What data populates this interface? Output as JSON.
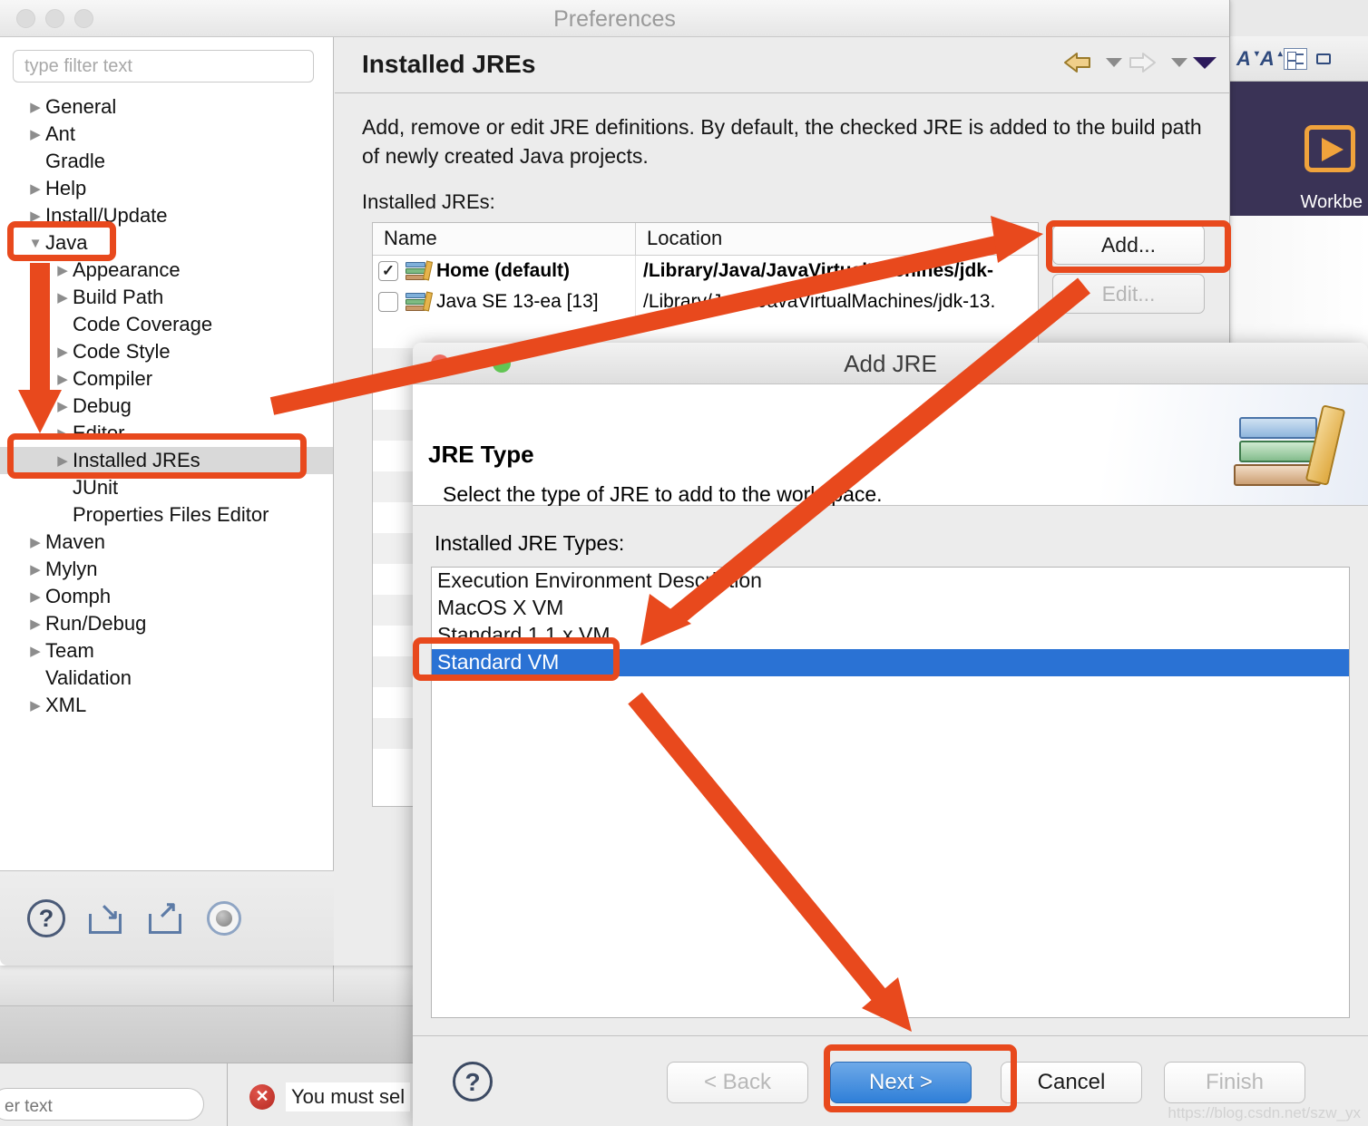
{
  "window": {
    "title": "Preferences",
    "traffic_lights": [
      "close",
      "minimize",
      "zoom"
    ]
  },
  "sidebar": {
    "filter_placeholder": "type filter text",
    "filter_value": "",
    "items": [
      {
        "label": "General",
        "level": 0,
        "twisty": "collapsed",
        "selected": false
      },
      {
        "label": "Ant",
        "level": 0,
        "twisty": "collapsed",
        "selected": false
      },
      {
        "label": "Gradle",
        "level": 0,
        "twisty": "none",
        "selected": false
      },
      {
        "label": "Help",
        "level": 0,
        "twisty": "collapsed",
        "selected": false
      },
      {
        "label": "Install/Update",
        "level": 0,
        "twisty": "collapsed",
        "selected": false
      },
      {
        "label": "Java",
        "level": 0,
        "twisty": "expanded",
        "selected": false
      },
      {
        "label": "Appearance",
        "level": 1,
        "twisty": "collapsed",
        "selected": false
      },
      {
        "label": "Build Path",
        "level": 1,
        "twisty": "collapsed",
        "selected": false
      },
      {
        "label": "Code Coverage",
        "level": 1,
        "twisty": "none",
        "selected": false
      },
      {
        "label": "Code Style",
        "level": 1,
        "twisty": "collapsed",
        "selected": false
      },
      {
        "label": "Compiler",
        "level": 1,
        "twisty": "collapsed",
        "selected": false
      },
      {
        "label": "Debug",
        "level": 1,
        "twisty": "collapsed",
        "selected": false
      },
      {
        "label": "Editor",
        "level": 1,
        "twisty": "collapsed",
        "selected": false
      },
      {
        "label": "Installed JREs",
        "level": 1,
        "twisty": "collapsed",
        "selected": true
      },
      {
        "label": "JUnit",
        "level": 1,
        "twisty": "none",
        "selected": false
      },
      {
        "label": "Properties Files Editor",
        "level": 1,
        "twisty": "none",
        "selected": false
      },
      {
        "label": "Maven",
        "level": 0,
        "twisty": "collapsed",
        "selected": false
      },
      {
        "label": "Mylyn",
        "level": 0,
        "twisty": "collapsed",
        "selected": false
      },
      {
        "label": "Oomph",
        "level": 0,
        "twisty": "collapsed",
        "selected": false
      },
      {
        "label": "Run/Debug",
        "level": 0,
        "twisty": "collapsed",
        "selected": false
      },
      {
        "label": "Team",
        "level": 0,
        "twisty": "collapsed",
        "selected": false
      },
      {
        "label": "Validation",
        "level": 0,
        "twisty": "none",
        "selected": false
      },
      {
        "label": "XML",
        "level": 0,
        "twisty": "collapsed",
        "selected": false
      }
    ],
    "bottom_icons": [
      "help-icon",
      "import-icon",
      "export-icon",
      "restore-defaults-icon"
    ]
  },
  "main": {
    "title": "Installed JREs",
    "description": "Add, remove or edit JRE definitions. By default, the checked JRE is added to the build path of newly created Java projects.",
    "table_label": "Installed JREs:",
    "nav": {
      "back_icon": "back-arrow-icon",
      "forward_icon": "forward-arrow-icon",
      "menu_icon": "chevron-down-icon"
    },
    "table": {
      "columns": [
        "Name",
        "Location"
      ],
      "rows": [
        {
          "checked": true,
          "name": "Home (default)",
          "location": "/Library/Java/JavaVirtualMachines/jdk-",
          "bold": true
        },
        {
          "checked": false,
          "name": "Java SE 13-ea [13]",
          "location": "/Library/Java/JavaVirtualMachines/jdk-13.",
          "bold": false
        }
      ]
    },
    "buttons": [
      {
        "label": "Add...",
        "disabled": false
      },
      {
        "label": "Edit...",
        "disabled": true
      }
    ]
  },
  "dialog": {
    "title": "Add JRE",
    "banner_title": "JRE Type",
    "banner_subtitle": "Select the type of JRE to add to the workspace.",
    "banner_icon": "books-stack-icon",
    "list_label": "Installed JRE Types:",
    "list_items": [
      {
        "label": "Execution Environment Description",
        "selected": false
      },
      {
        "label": "MacOS X VM",
        "selected": false
      },
      {
        "label": "Standard 1.1.x VM",
        "selected": false
      },
      {
        "label": "Standard VM",
        "selected": true
      }
    ],
    "help_icon": "help-icon",
    "buttons": [
      {
        "id": "btn-back",
        "label": "< Back",
        "disabled": true,
        "primary": false
      },
      {
        "id": "btn-next",
        "label": "Next >",
        "disabled": false,
        "primary": true
      },
      {
        "id": "btn-cancel",
        "label": "Cancel",
        "disabled": false,
        "primary": false
      },
      {
        "id": "btn-finish",
        "label": "Finish",
        "disabled": true,
        "primary": false
      }
    ],
    "watermark": "https://blog.csdn.net/szw_yx"
  },
  "background": {
    "workbench_label": "Workbe",
    "error_message": "You must sel",
    "error_icon": "error-icon",
    "filter_placeholder_partial": "er text",
    "toolbar_icons": [
      "font-decrease-icon",
      "font-increase-icon",
      "checklist-icon",
      "panel-icon"
    ]
  },
  "colors": {
    "annotation": "#e8491d",
    "selection": "#2a72d4",
    "primary_button": "#2f7fd8",
    "error": "#c0392b"
  }
}
